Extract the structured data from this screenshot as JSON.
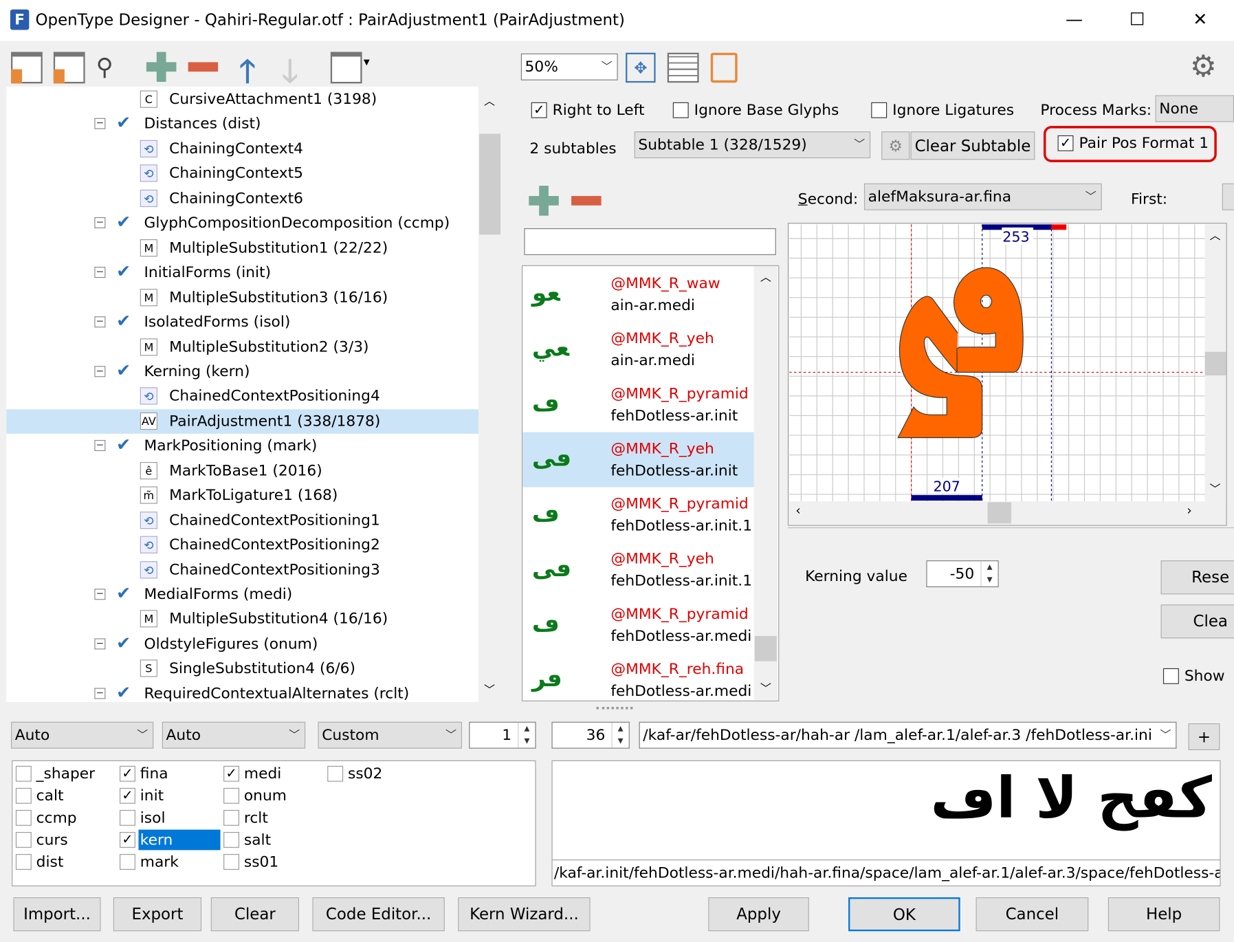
{
  "window": {
    "title": "OpenType Designer - Qahiri-Regular.otf : PairAdjustment1 (PairAdjustment)",
    "minimize": "—",
    "maximize": "☐",
    "close": "✕"
  },
  "tree": {
    "items": [
      {
        "level": 2,
        "icon": "C",
        "label": "CursiveAttachment1 (3198)"
      },
      {
        "level": 1,
        "label": "Distances (dist)"
      },
      {
        "level": 2,
        "icon": "chain",
        "label": "ChainingContext4"
      },
      {
        "level": 2,
        "icon": "chain",
        "label": "ChainingContext5"
      },
      {
        "level": 2,
        "icon": "chain",
        "label": "ChainingContext6"
      },
      {
        "level": 1,
        "label": "GlyphCompositionDecomposition (ccmp)"
      },
      {
        "level": 2,
        "icon": "M",
        "label": "MultipleSubstitution1 (22/22)"
      },
      {
        "level": 1,
        "label": "InitialForms (init)"
      },
      {
        "level": 2,
        "icon": "M",
        "label": "MultipleSubstitution3 (16/16)"
      },
      {
        "level": 1,
        "label": "IsolatedForms (isol)"
      },
      {
        "level": 2,
        "icon": "M",
        "label": "MultipleSubstitution2 (3/3)"
      },
      {
        "level": 1,
        "label": "Kerning (kern)"
      },
      {
        "level": 2,
        "icon": "chain",
        "label": "ChainedContextPositioning4"
      },
      {
        "level": 2,
        "icon": "AV",
        "label": "PairAdjustment1 (338/1878)",
        "selected": true
      },
      {
        "level": 1,
        "label": "MarkPositioning (mark)"
      },
      {
        "level": 2,
        "icon": "ê",
        "label": "MarkToBase1 (2016)"
      },
      {
        "level": 2,
        "icon": "m̃",
        "label": "MarkToLigature1 (168)"
      },
      {
        "level": 2,
        "icon": "chain",
        "label": "ChainedContextPositioning1"
      },
      {
        "level": 2,
        "icon": "chain",
        "label": "ChainedContextPositioning2"
      },
      {
        "level": 2,
        "icon": "chain",
        "label": "ChainedContextPositioning3"
      },
      {
        "level": 1,
        "label": "MedialForms (medi)"
      },
      {
        "level": 2,
        "icon": "M",
        "label": "MultipleSubstitution4 (16/16)"
      },
      {
        "level": 1,
        "label": "OldstyleFigures (onum)"
      },
      {
        "level": 2,
        "icon": "S",
        "label": "SingleSubstitution4 (6/6)"
      },
      {
        "level": 1,
        "label": "RequiredContextualAlternates (rclt)"
      }
    ]
  },
  "editor": {
    "zoom": "50%",
    "right_to_left": "Right to Left",
    "right_to_left_checked": true,
    "ignore_base": "Ignore Base Glyphs",
    "ignore_base_checked": false,
    "ignore_lig": "Ignore Ligatures",
    "ignore_lig_checked": false,
    "process_marks_label": "Process Marks:",
    "process_marks": "None",
    "subtables": "2 subtables",
    "subtable": "Subtable 1 (328/1529)",
    "clear_subtable": "Clear Subtable",
    "pair_pos_format": "Pair Pos Format 1",
    "pair_pos_checked": true,
    "second_label": "Second:",
    "second_value": "alefMaksura-ar.fina",
    "first_label": "First:",
    "search_value": "",
    "pairs": [
      {
        "glyph": "ﻌﻮ",
        "class": "@MMK_R_waw",
        "name": "ain-ar.medi"
      },
      {
        "glyph": "ﻌﻲ",
        "class": "@MMK_R_yeh",
        "name": "ain-ar.medi"
      },
      {
        "glyph": "ڡ",
        "class": "@MMK_R_pyramid",
        "name": "fehDotless-ar.init"
      },
      {
        "glyph": "ڡى",
        "class": "@MMK_R_yeh",
        "name": "fehDotless-ar.init",
        "selected": true
      },
      {
        "glyph": "ڡ",
        "class": "@MMK_R_pyramid",
        "name": "fehDotless-ar.init.1"
      },
      {
        "glyph": "ڡى",
        "class": "@MMK_R_yeh",
        "name": "fehDotless-ar.init.1"
      },
      {
        "glyph": "ڡ",
        "class": "@MMK_R_pyramid",
        "name": "fehDotless-ar.medi"
      },
      {
        "glyph": "ڡر",
        "class": "@MMK_R_reh.fina",
        "name": "fehDotless-ar.medi"
      }
    ],
    "canvas": {
      "top_value": "253",
      "bottom_value": "207",
      "glyph_color": "#ff6600"
    },
    "kerning_label": "Kerning value",
    "kerning_value": "-50",
    "reset": "Rese",
    "clear": "Clea",
    "show": "Show",
    "show_checked": false
  },
  "preview": {
    "combo1": "Auto",
    "combo2": "Auto",
    "combo3": "Custom",
    "spin1": "1",
    "size": "36",
    "text": "/kaf-ar/fehDotless-ar/hah-ar /lam_alef-ar.1/alef-ar.3 /fehDotless-ar.ini",
    "add": "+",
    "features": [
      {
        "tag": "_shaper",
        "on": false
      },
      {
        "tag": "calt",
        "on": false
      },
      {
        "tag": "ccmp",
        "on": false
      },
      {
        "tag": "curs",
        "on": false
      },
      {
        "tag": "dist",
        "on": false
      },
      {
        "tag": "fina",
        "on": true
      },
      {
        "tag": "init",
        "on": true
      },
      {
        "tag": "isol",
        "on": false
      },
      {
        "tag": "kern",
        "on": true,
        "selected": true
      },
      {
        "tag": "mark",
        "on": false
      },
      {
        "tag": "medi",
        "on": true
      },
      {
        "tag": "onum",
        "on": false
      },
      {
        "tag": "rclt",
        "on": false
      },
      {
        "tag": "salt",
        "on": false
      },
      {
        "tag": "ss01",
        "on": false
      },
      {
        "tag": "ss02",
        "on": false
      }
    ],
    "sample": "كڡح لا اڡ",
    "glyph_string": "/kaf-ar.init/fehDotless-ar.medi/hah-ar.fina/space/lam_alef-ar.1/alef-ar.3/space/fehDotless-a"
  },
  "buttons": {
    "import": "Import...",
    "export": "Export",
    "clear": "Clear",
    "code_editor": "Code Editor...",
    "kern_wizard": "Kern Wizard...",
    "apply": "Apply",
    "ok": "OK",
    "cancel": "Cancel",
    "help": "Help"
  }
}
